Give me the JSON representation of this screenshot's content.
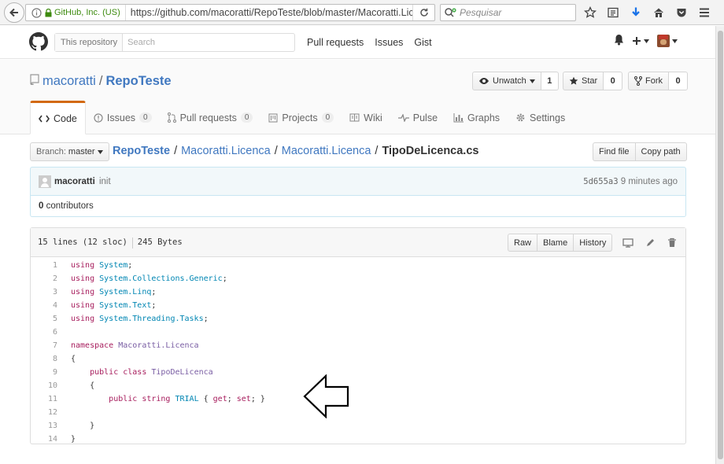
{
  "browser": {
    "identity": "GitHub, Inc. (US)",
    "url": "https://github.com/macoratti/RepoTeste/blob/master/Macoratti.Lice",
    "search_placeholder": "Pesquisar"
  },
  "header": {
    "search_scope": "This repository",
    "search_placeholder": "Search",
    "nav": [
      "Pull requests",
      "Issues",
      "Gist"
    ]
  },
  "repo": {
    "owner": "macoratti",
    "name": "RepoTeste",
    "watch_label": "Unwatch",
    "watch_count": "1",
    "star_label": "Star",
    "star_count": "0",
    "fork_label": "Fork",
    "fork_count": "0",
    "tabs": [
      {
        "label": "Code"
      },
      {
        "label": "Issues",
        "count": "0"
      },
      {
        "label": "Pull requests",
        "count": "0"
      },
      {
        "label": "Projects",
        "count": "0"
      },
      {
        "label": "Wiki"
      },
      {
        "label": "Pulse"
      },
      {
        "label": "Graphs"
      },
      {
        "label": "Settings"
      }
    ]
  },
  "file_nav": {
    "branch_label": "Branch:",
    "branch": "master",
    "breadcrumb": [
      "RepoTeste",
      "Macoratti.Licenca",
      "Macoratti.Licenca",
      "TipoDeLicenca.cs"
    ],
    "find_file": "Find file",
    "copy_path": "Copy path"
  },
  "commit": {
    "author": "macoratti",
    "message": "init",
    "sha": "5d655a3",
    "time": "9 minutes ago",
    "contributors_count": "0",
    "contributors_label": "contributors"
  },
  "file": {
    "lines_info": "15 lines (12 sloc)",
    "size": "245 Bytes",
    "raw": "Raw",
    "blame": "Blame",
    "history": "History"
  },
  "code_lines": [
    "using System;",
    "using System.Collections.Generic;",
    "using System.Linq;",
    "using System.Text;",
    "using System.Threading.Tasks;",
    "",
    "namespace Macoratti.Licenca",
    "{",
    "    public class TipoDeLicenca",
    "    {",
    "        public string TRIAL { get; set; }",
    "",
    "    }",
    "}"
  ]
}
